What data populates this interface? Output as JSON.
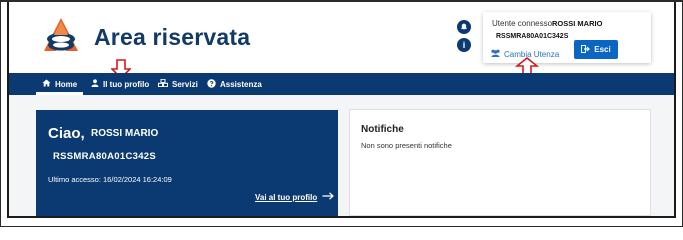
{
  "header": {
    "app_title": "Area riservata",
    "logo_icon": "agenzia-entrate-logo",
    "bell_icon": "bell-icon",
    "info_icon": "info-icon"
  },
  "user_box": {
    "connected_label": "Utente connesso:",
    "user_name": "ROSSI MARIO",
    "fiscal_code": "RSSMRA80A01C342S",
    "switch_user_label": "Cambia Utenza",
    "logout_label": "Esci"
  },
  "nav": {
    "items": [
      {
        "label": "Home",
        "icon": "home-icon",
        "active": true
      },
      {
        "label": "Il tuo profilo",
        "icon": "user-icon",
        "active": false
      },
      {
        "label": "Servizi",
        "icon": "services-icon",
        "active": false
      },
      {
        "label": "Assistenza",
        "icon": "help-icon",
        "active": false
      }
    ]
  },
  "welcome": {
    "greeting": "Ciao,",
    "user_name": "ROSSI MARIO",
    "fiscal_code": "RSSMRA80A01C342S",
    "last_access": "Ultimo accesso: 16/02/2024 16:24:09",
    "profile_link": "Vai al tuo profilo"
  },
  "notifications": {
    "title": "Notifiche",
    "empty_text": "Non sono presenti notifiche"
  },
  "colors": {
    "brand_dark": "#0b3a72",
    "accent_blue": "#0b66c3",
    "annotation_red": "#d11a1a"
  }
}
